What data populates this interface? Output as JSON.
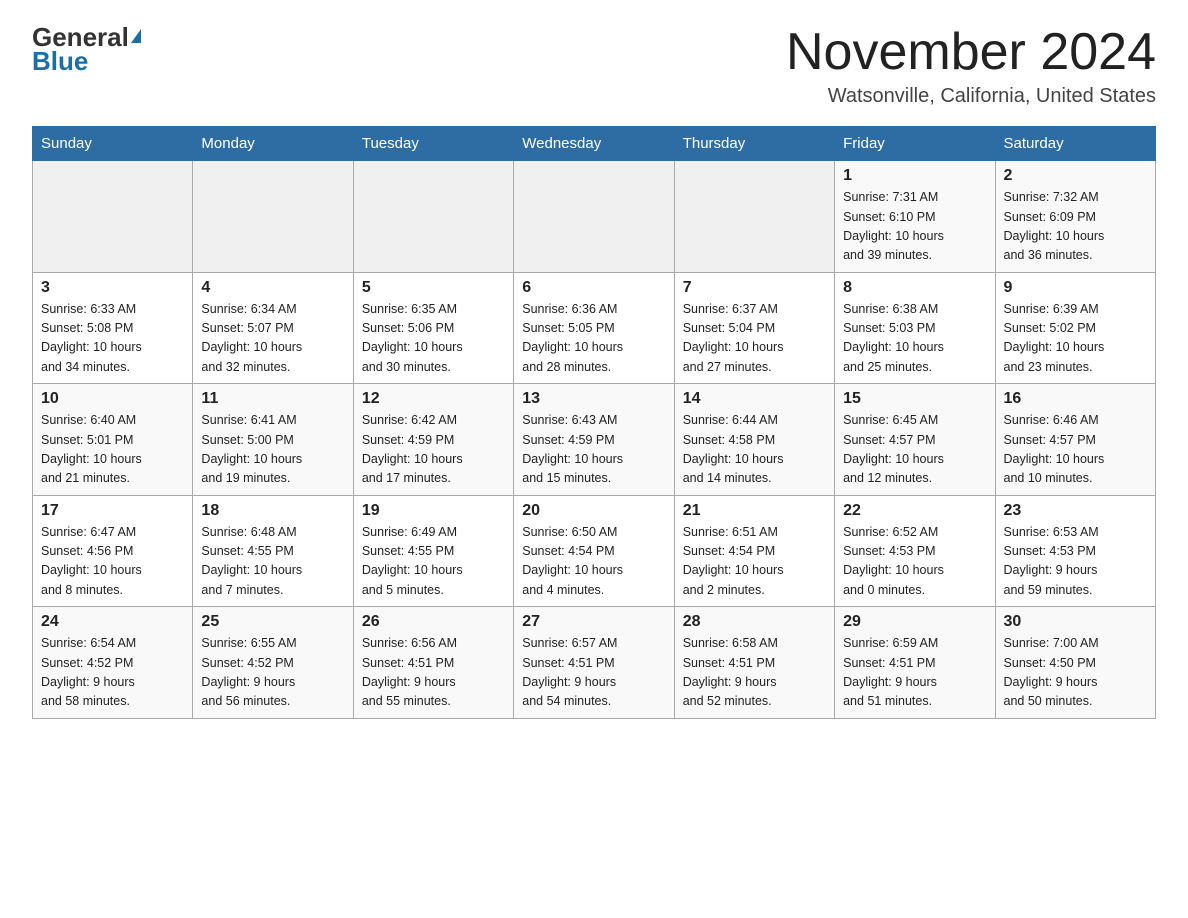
{
  "header": {
    "logo_general": "General",
    "logo_blue": "Blue",
    "month_title": "November 2024",
    "location": "Watsonville, California, United States"
  },
  "weekdays": [
    "Sunday",
    "Monday",
    "Tuesday",
    "Wednesday",
    "Thursday",
    "Friday",
    "Saturday"
  ],
  "weeks": [
    [
      {
        "day": "",
        "info": ""
      },
      {
        "day": "",
        "info": ""
      },
      {
        "day": "",
        "info": ""
      },
      {
        "day": "",
        "info": ""
      },
      {
        "day": "",
        "info": ""
      },
      {
        "day": "1",
        "info": "Sunrise: 7:31 AM\nSunset: 6:10 PM\nDaylight: 10 hours\nand 39 minutes."
      },
      {
        "day": "2",
        "info": "Sunrise: 7:32 AM\nSunset: 6:09 PM\nDaylight: 10 hours\nand 36 minutes."
      }
    ],
    [
      {
        "day": "3",
        "info": "Sunrise: 6:33 AM\nSunset: 5:08 PM\nDaylight: 10 hours\nand 34 minutes."
      },
      {
        "day": "4",
        "info": "Sunrise: 6:34 AM\nSunset: 5:07 PM\nDaylight: 10 hours\nand 32 minutes."
      },
      {
        "day": "5",
        "info": "Sunrise: 6:35 AM\nSunset: 5:06 PM\nDaylight: 10 hours\nand 30 minutes."
      },
      {
        "day": "6",
        "info": "Sunrise: 6:36 AM\nSunset: 5:05 PM\nDaylight: 10 hours\nand 28 minutes."
      },
      {
        "day": "7",
        "info": "Sunrise: 6:37 AM\nSunset: 5:04 PM\nDaylight: 10 hours\nand 27 minutes."
      },
      {
        "day": "8",
        "info": "Sunrise: 6:38 AM\nSunset: 5:03 PM\nDaylight: 10 hours\nand 25 minutes."
      },
      {
        "day": "9",
        "info": "Sunrise: 6:39 AM\nSunset: 5:02 PM\nDaylight: 10 hours\nand 23 minutes."
      }
    ],
    [
      {
        "day": "10",
        "info": "Sunrise: 6:40 AM\nSunset: 5:01 PM\nDaylight: 10 hours\nand 21 minutes."
      },
      {
        "day": "11",
        "info": "Sunrise: 6:41 AM\nSunset: 5:00 PM\nDaylight: 10 hours\nand 19 minutes."
      },
      {
        "day": "12",
        "info": "Sunrise: 6:42 AM\nSunset: 4:59 PM\nDaylight: 10 hours\nand 17 minutes."
      },
      {
        "day": "13",
        "info": "Sunrise: 6:43 AM\nSunset: 4:59 PM\nDaylight: 10 hours\nand 15 minutes."
      },
      {
        "day": "14",
        "info": "Sunrise: 6:44 AM\nSunset: 4:58 PM\nDaylight: 10 hours\nand 14 minutes."
      },
      {
        "day": "15",
        "info": "Sunrise: 6:45 AM\nSunset: 4:57 PM\nDaylight: 10 hours\nand 12 minutes."
      },
      {
        "day": "16",
        "info": "Sunrise: 6:46 AM\nSunset: 4:57 PM\nDaylight: 10 hours\nand 10 minutes."
      }
    ],
    [
      {
        "day": "17",
        "info": "Sunrise: 6:47 AM\nSunset: 4:56 PM\nDaylight: 10 hours\nand 8 minutes."
      },
      {
        "day": "18",
        "info": "Sunrise: 6:48 AM\nSunset: 4:55 PM\nDaylight: 10 hours\nand 7 minutes."
      },
      {
        "day": "19",
        "info": "Sunrise: 6:49 AM\nSunset: 4:55 PM\nDaylight: 10 hours\nand 5 minutes."
      },
      {
        "day": "20",
        "info": "Sunrise: 6:50 AM\nSunset: 4:54 PM\nDaylight: 10 hours\nand 4 minutes."
      },
      {
        "day": "21",
        "info": "Sunrise: 6:51 AM\nSunset: 4:54 PM\nDaylight: 10 hours\nand 2 minutes."
      },
      {
        "day": "22",
        "info": "Sunrise: 6:52 AM\nSunset: 4:53 PM\nDaylight: 10 hours\nand 0 minutes."
      },
      {
        "day": "23",
        "info": "Sunrise: 6:53 AM\nSunset: 4:53 PM\nDaylight: 9 hours\nand 59 minutes."
      }
    ],
    [
      {
        "day": "24",
        "info": "Sunrise: 6:54 AM\nSunset: 4:52 PM\nDaylight: 9 hours\nand 58 minutes."
      },
      {
        "day": "25",
        "info": "Sunrise: 6:55 AM\nSunset: 4:52 PM\nDaylight: 9 hours\nand 56 minutes."
      },
      {
        "day": "26",
        "info": "Sunrise: 6:56 AM\nSunset: 4:51 PM\nDaylight: 9 hours\nand 55 minutes."
      },
      {
        "day": "27",
        "info": "Sunrise: 6:57 AM\nSunset: 4:51 PM\nDaylight: 9 hours\nand 54 minutes."
      },
      {
        "day": "28",
        "info": "Sunrise: 6:58 AM\nSunset: 4:51 PM\nDaylight: 9 hours\nand 52 minutes."
      },
      {
        "day": "29",
        "info": "Sunrise: 6:59 AM\nSunset: 4:51 PM\nDaylight: 9 hours\nand 51 minutes."
      },
      {
        "day": "30",
        "info": "Sunrise: 7:00 AM\nSunset: 4:50 PM\nDaylight: 9 hours\nand 50 minutes."
      }
    ]
  ]
}
